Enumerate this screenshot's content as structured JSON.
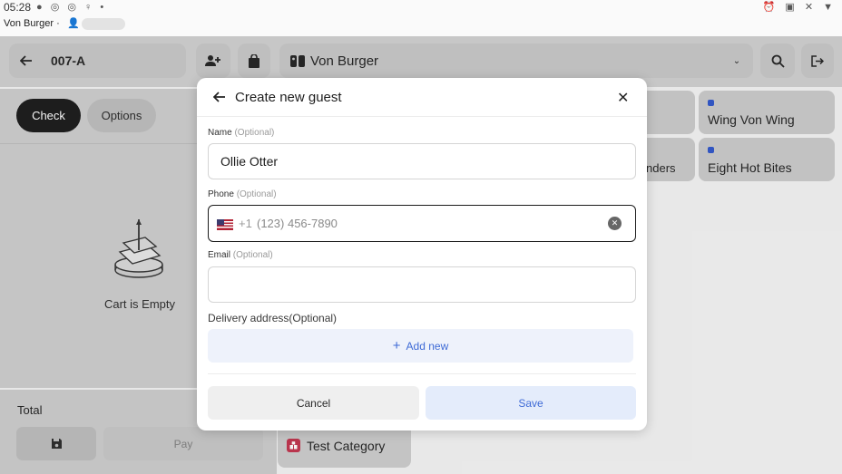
{
  "status_bar": {
    "time": "05:28",
    "left_icons": "● ◎ ◎ ♀ •",
    "right_icons": "⏰ ▣ ✕ ▼",
    "app_name": "Von Burger ·"
  },
  "top_bar": {
    "order_id": "007-A",
    "restaurant_name": "Von Burger",
    "icons": [
      "back-arrow-icon",
      "add-guest-icon",
      "bag-icon",
      "store-icon",
      "chevron-down-icon",
      "search-icon",
      "logout-icon"
    ]
  },
  "left_panel": {
    "tabs": [
      {
        "label": "Check",
        "active": true
      },
      {
        "label": "Options",
        "active": false
      }
    ],
    "empty_text": "Cart is Empty",
    "total_label": "Total",
    "pay_label": "Pay"
  },
  "categories": [
    {
      "label": "Wing Von Wing",
      "dot": true
    },
    {
      "label": "Eight Hot Bites",
      "dot": true
    },
    {
      "label": "nders",
      "dot": false
    },
    {
      "label": "Test Category",
      "dot": false
    }
  ],
  "modal": {
    "title": "Create new guest",
    "name_label": "Name",
    "name_optional": "(Optional)",
    "name_value": "Ollie Otter",
    "phone_label": "Phone",
    "phone_optional": "(Optional)",
    "phone_code": "+1",
    "phone_placeholder": "(123) 456-7890",
    "email_label": "Email",
    "email_optional": "(Optional)",
    "email_value": "",
    "address_label": "Delivery address(Optional)",
    "add_new_label": "Add new",
    "cancel_label": "Cancel",
    "save_label": "Save"
  },
  "colors": {
    "accent_blue": "#2f56c8",
    "save_bg": "#e4ecfb",
    "save_text": "#3f6bd6",
    "add_new_bg": "#eef2fb",
    "check_pill": "#1a1a1a",
    "test_category_icon": "#c0334d"
  }
}
